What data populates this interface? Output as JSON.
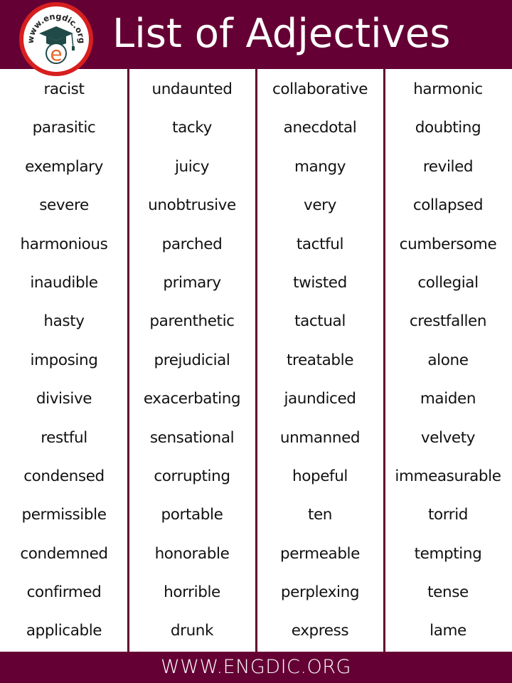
{
  "header": {
    "title": "List of Adjectives",
    "logo_text": "www.engdic.org",
    "logo_letter": "e",
    "colors": {
      "bar": "#650034",
      "logo_ring": "#d71f1f",
      "logo_letter": "#e8692a",
      "cap": "#1f4a48"
    }
  },
  "columns": [
    {
      "words": [
        "racist",
        "parasitic",
        "exemplary",
        "severe",
        "harmonious",
        "inaudible",
        "hasty",
        "imposing",
        "divisive",
        "restful",
        "condensed",
        "permissible",
        "condemned",
        "confirmed",
        "applicable"
      ]
    },
    {
      "words": [
        "undaunted",
        "tacky",
        "juicy",
        "unobtrusive",
        "parched",
        "primary",
        "parenthetic",
        "prejudicial",
        "exacerbating",
        "sensational",
        "corrupting",
        "portable",
        "honorable",
        "horrible",
        "drunk"
      ]
    },
    {
      "words": [
        "collaborative",
        "anecdotal",
        "mangy",
        "very",
        "tactful",
        "twisted",
        "tactual",
        "treatable",
        "jaundiced",
        "unmanned",
        "hopeful",
        "ten",
        "permeable",
        "perplexing",
        "express"
      ]
    },
    {
      "words": [
        "harmonic",
        "doubting",
        "reviled",
        "collapsed",
        "cumbersome",
        "collegial",
        "crestfallen",
        "alone",
        "maiden",
        "velvety",
        "immeasurable",
        "torrid",
        "tempting",
        "tense",
        "lame"
      ]
    }
  ],
  "footer": {
    "text": "WWW.ENGDIC.ORG"
  }
}
